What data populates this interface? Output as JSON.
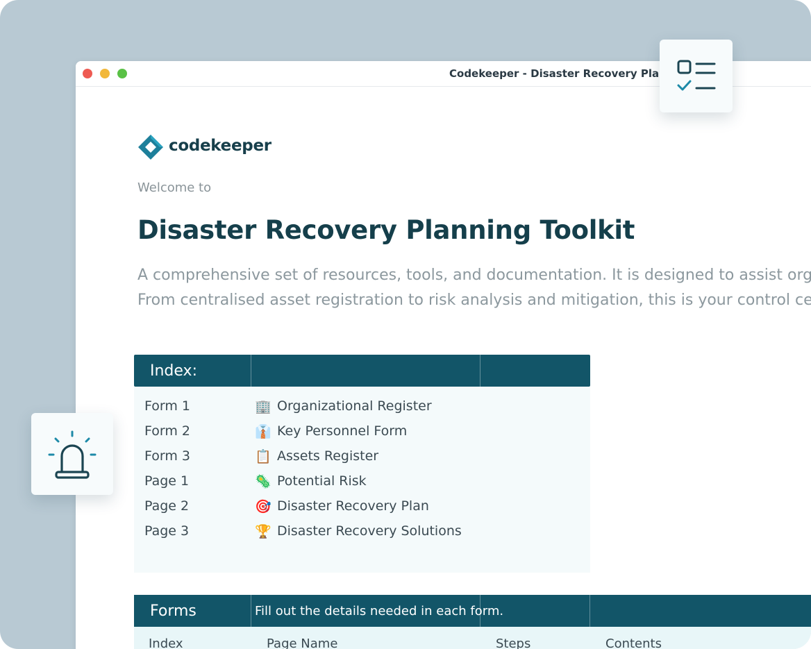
{
  "window": {
    "title": "Codekeeper - Disaster Recovery Planning"
  },
  "brand": {
    "name": "codekeeper",
    "color": "#1d7f9a"
  },
  "hero": {
    "welcome": "Welcome to",
    "title": "Disaster Recovery Planning Toolkit",
    "description_line1": "A comprehensive set of resources, tools, and documentation. It is designed to assist org",
    "description_line2": "From centralised asset registration to risk analysis and mitigation, this is your control ce"
  },
  "index": {
    "title": "Index:",
    "items": [
      {
        "code": "Form 1",
        "emoji": "🏢",
        "label": "Organizational Register"
      },
      {
        "code": "Form 2",
        "emoji": "👔",
        "label": "Key Personnel Form"
      },
      {
        "code": "Form 3",
        "emoji": "📋",
        "label": "Assets Register"
      },
      {
        "code": "Page 1",
        "emoji": "🦠",
        "label": "Potential Risk"
      },
      {
        "code": "Page 2",
        "emoji": "🎯",
        "label": "Disaster Recovery Plan"
      },
      {
        "code": "Page 3",
        "emoji": "🏆",
        "label": "Disaster Recovery Solutions"
      }
    ]
  },
  "forms": {
    "title": "Forms",
    "subtitle": "Fill out the details needed in each form.",
    "columns": [
      "Index",
      "Page Name",
      "Steps",
      "Contents"
    ]
  },
  "colors": {
    "header_bg": "#125568",
    "frame_bg": "#b8c9d3",
    "title_text": "#153f4b"
  },
  "icons": {
    "checklist": "checklist-icon",
    "alarm": "alarm-siren-icon"
  }
}
